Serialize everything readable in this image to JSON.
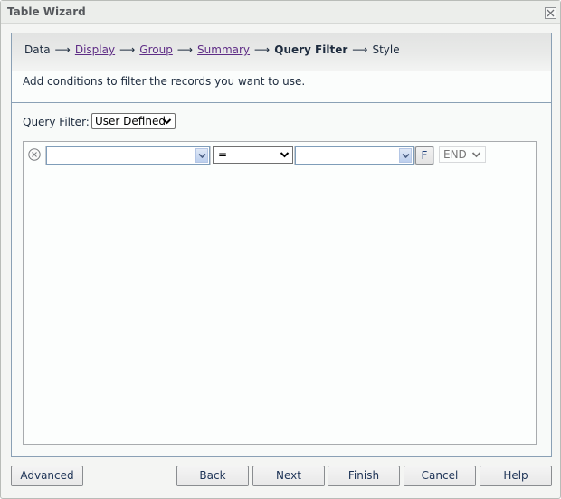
{
  "window": {
    "title": "Table Wizard",
    "close_icon": "close-x-icon"
  },
  "steps": [
    {
      "label": "Data",
      "state": "plain"
    },
    {
      "label": "Display",
      "state": "link"
    },
    {
      "label": "Group",
      "state": "link"
    },
    {
      "label": "Summary",
      "state": "link"
    },
    {
      "label": "Query Filter",
      "state": "current"
    },
    {
      "label": "Style",
      "state": "plain"
    }
  ],
  "step_arrow": "⟶",
  "description": "Add conditions to filter the records you want to use.",
  "query_filter": {
    "label": "Query Filter:",
    "selected": "User Defined"
  },
  "condition_row": {
    "remove_icon": "remove-circle-x-icon",
    "field_value": "",
    "operator": "=",
    "value": "",
    "formula_button": "F",
    "logic": "END"
  },
  "buttons": {
    "advanced": "Advanced",
    "back": "Back",
    "next": "Next",
    "finish": "Finish",
    "cancel": "Cancel",
    "help": "Help"
  }
}
